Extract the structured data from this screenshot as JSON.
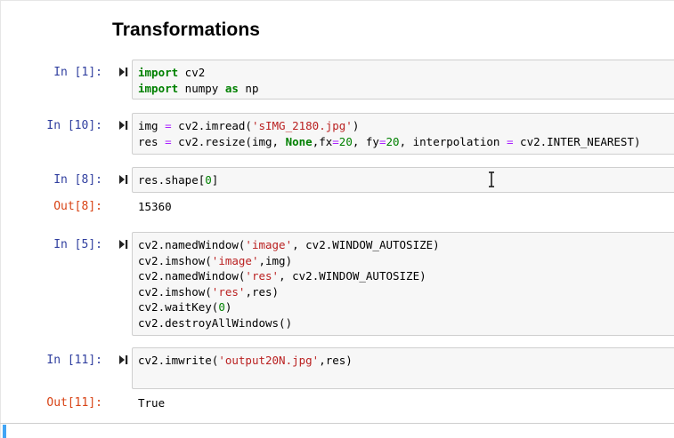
{
  "heading": "Transformations",
  "cells": [
    {
      "prompt": "In [1]:",
      "lines": [
        [
          [
            "kw",
            "import"
          ],
          [
            "t",
            " cv2"
          ]
        ],
        [
          [
            "kw",
            "import"
          ],
          [
            "t",
            " numpy "
          ],
          [
            "kw",
            "as"
          ],
          [
            "t",
            " np"
          ]
        ]
      ]
    },
    {
      "prompt": "In [10]:",
      "lines": [
        [
          [
            "t",
            "img "
          ],
          [
            "op",
            "="
          ],
          [
            "t",
            " cv2.imread("
          ],
          [
            "st",
            "'sIMG_2180.jpg'"
          ],
          [
            "t",
            ")"
          ]
        ],
        [
          [
            "t",
            "res "
          ],
          [
            "op",
            "="
          ],
          [
            "t",
            " cv2.resize(img, "
          ],
          [
            "bi",
            "None"
          ],
          [
            "t",
            ",fx"
          ],
          [
            "op",
            "="
          ],
          [
            "nu",
            "20"
          ],
          [
            "t",
            ", fy"
          ],
          [
            "op",
            "="
          ],
          [
            "nu",
            "20"
          ],
          [
            "t",
            ", interpolation "
          ],
          [
            "op",
            "="
          ],
          [
            "t",
            " cv2.INTER_NEAREST)"
          ]
        ]
      ]
    },
    {
      "prompt": "In [8]:",
      "lines": [
        [
          [
            "t",
            "res.shape["
          ],
          [
            "nu",
            "0"
          ],
          [
            "t",
            "]"
          ]
        ]
      ],
      "out_prompt": "Out[8]:",
      "out_text": "15360"
    },
    {
      "prompt": "In [5]:",
      "lines": [
        [
          [
            "t",
            "cv2.namedWindow("
          ],
          [
            "st",
            "'image'"
          ],
          [
            "t",
            ", cv2.WINDOW_AUTOSIZE)"
          ]
        ],
        [
          [
            "t",
            "cv2.imshow("
          ],
          [
            "st",
            "'image'"
          ],
          [
            "t",
            ",img)"
          ]
        ],
        [
          [
            "t",
            "cv2.namedWindow("
          ],
          [
            "st",
            "'res'"
          ],
          [
            "t",
            ", cv2.WINDOW_AUTOSIZE)"
          ]
        ],
        [
          [
            "t",
            "cv2.imshow("
          ],
          [
            "st",
            "'res'"
          ],
          [
            "t",
            ",res)"
          ]
        ],
        [
          [
            "t",
            "cv2.waitKey("
          ],
          [
            "nu",
            "0"
          ],
          [
            "t",
            ")"
          ]
        ],
        [
          [
            "t",
            "cv2.destroyAllWindows()"
          ]
        ]
      ]
    },
    {
      "prompt": "In [11]:",
      "lines": [
        [
          [
            "t",
            "cv2.imwrite("
          ],
          [
            "st",
            "'output20N.jpg'"
          ],
          [
            "t",
            ",res)"
          ]
        ]
      ],
      "out_prompt": "Out[11]:",
      "out_text": "True"
    }
  ],
  "icons": {
    "run": "step-run-icon",
    "cursor": "text-cursor-icon"
  }
}
